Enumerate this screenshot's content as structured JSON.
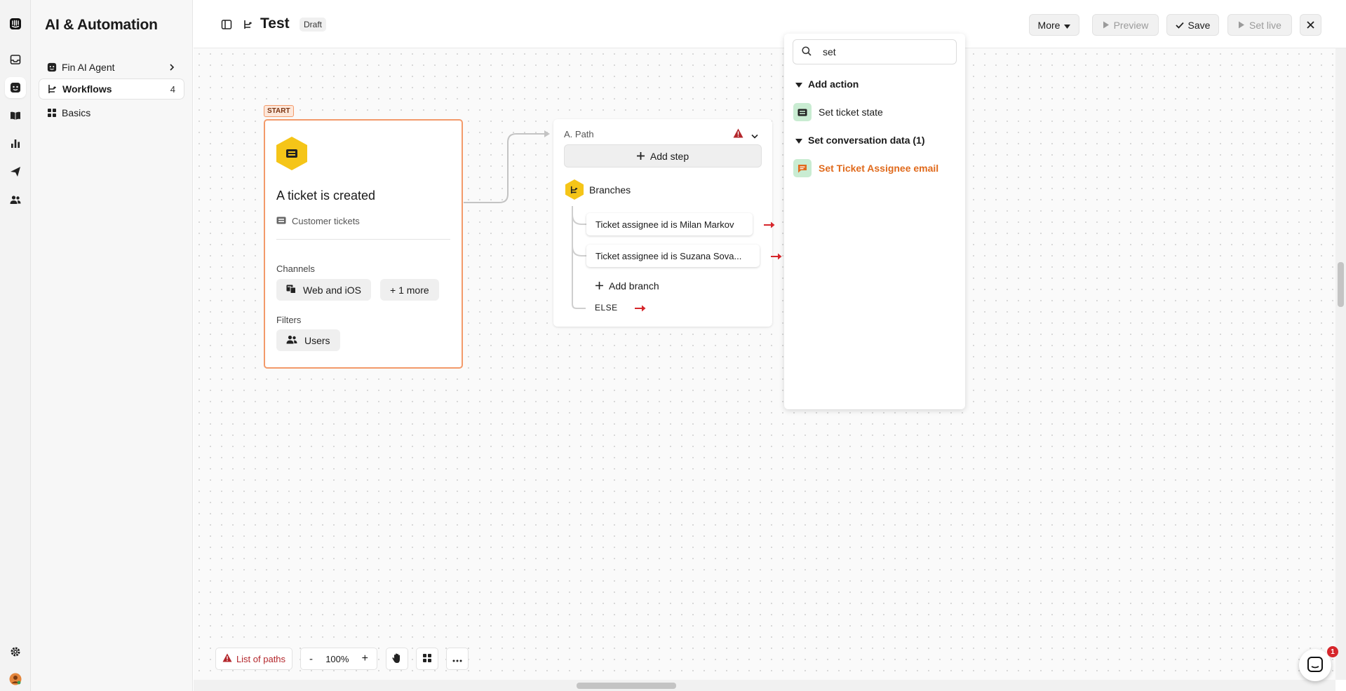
{
  "app": {
    "section_title": "AI & Automation"
  },
  "rail_icons": [
    "inbox-icon",
    "fin-agent-icon",
    "knowledge-book-icon",
    "reports-icon",
    "outbound-icon",
    "contacts-icon",
    "settings-icon",
    "profile-avatar"
  ],
  "sidebar": {
    "items": [
      {
        "label": "Fin AI Agent",
        "icon": "fin-agent-icon"
      },
      {
        "label": "Workflows",
        "count": "4",
        "icon": "workflow-icon"
      },
      {
        "label": "Basics",
        "icon": "grid-icon"
      }
    ]
  },
  "header": {
    "title": "Test",
    "status_badge": "Draft",
    "more_label": "More",
    "preview_label": "Preview",
    "save_label": "Save",
    "set_live_label": "Set live"
  },
  "trigger": {
    "start_tag": "START",
    "title": "A ticket is created",
    "subtitle": "Customer tickets",
    "channels_label": "Channels",
    "channel_chip": "Web and iOS",
    "more_chip": "+ 1 more",
    "filters_label": "Filters",
    "filter_chip": "Users"
  },
  "path": {
    "title": "A. Path",
    "add_step_label": "Add step",
    "branches_label": "Branches",
    "branches": [
      "Ticket assignee id is Milan Markov",
      "Ticket assignee id is Suzana Sova..."
    ],
    "add_branch_label": "Add branch",
    "else_label": "ELSE"
  },
  "popover": {
    "search_value": "set",
    "sections": [
      {
        "title": "Add action",
        "items": [
          "Set ticket state"
        ]
      },
      {
        "title": "Set conversation data (1)",
        "items": [
          "Set Ticket Assignee email"
        ]
      }
    ]
  },
  "toolbar": {
    "list_of_paths": "List of paths",
    "zoom_minus": "-",
    "zoom_level": "100%",
    "zoom_plus": "+"
  },
  "messenger": {
    "badge_count": "1"
  },
  "colors": {
    "accent_orange": "#f39a6a",
    "warning_red": "#d6262b",
    "hex_yellow": "#f5c518",
    "action_green": "#c9ecd2",
    "highlight_text": "#e06a1c"
  }
}
